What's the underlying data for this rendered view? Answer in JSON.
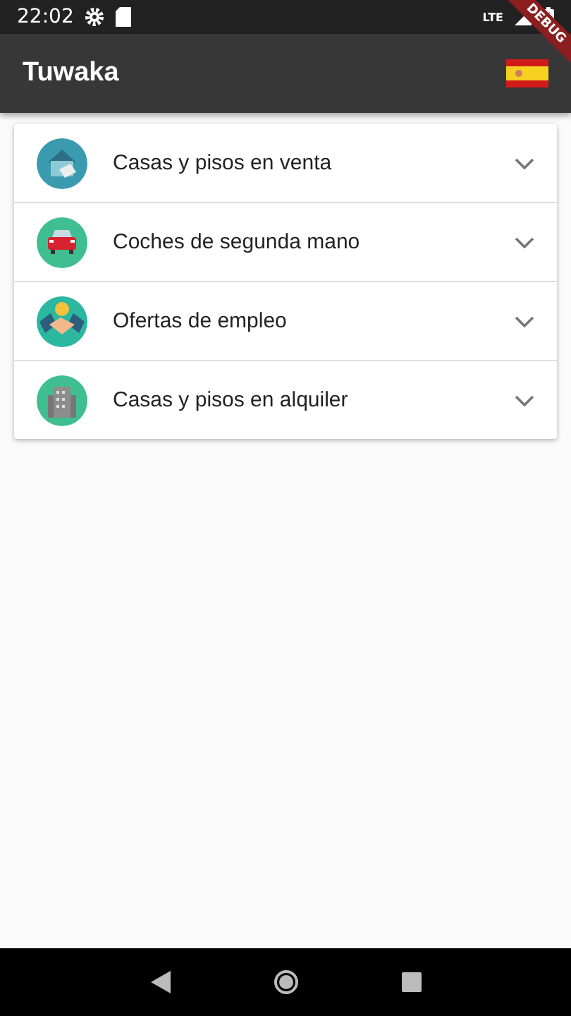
{
  "status_bar": {
    "time": "22:02",
    "network": "LTE"
  },
  "debug_banner": "DEBUG",
  "app_bar": {
    "title": "Tuwaka"
  },
  "categories": [
    {
      "kind": "house",
      "label": "Casas y pisos en venta",
      "expanded": false
    },
    {
      "kind": "car",
      "label": "Coches de segunda mano",
      "expanded": false
    },
    {
      "kind": "handshake",
      "label": "Ofertas de empleo",
      "expanded": false
    },
    {
      "kind": "building",
      "label": "Casas y pisos en alquiler",
      "expanded": false
    }
  ]
}
